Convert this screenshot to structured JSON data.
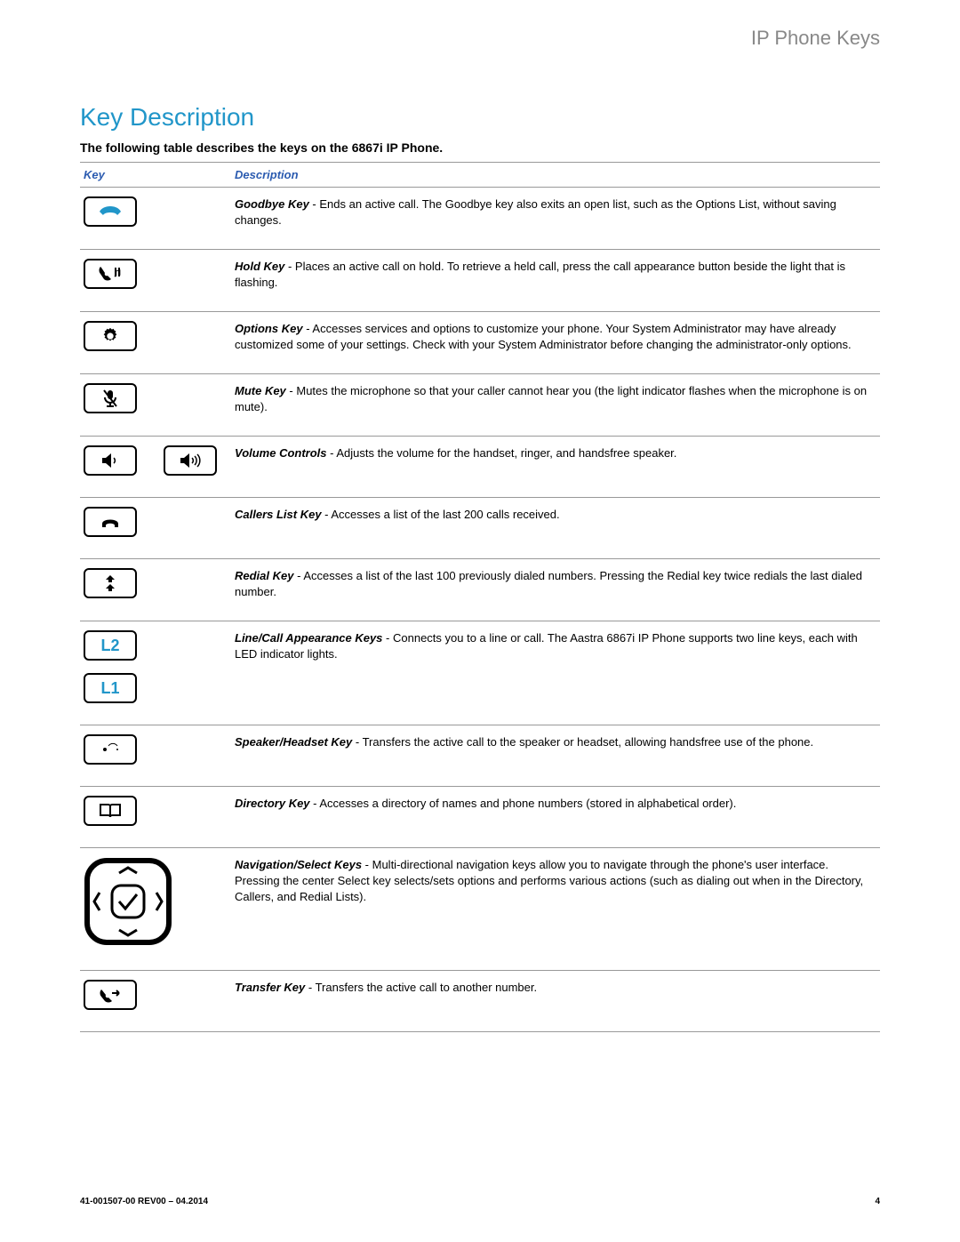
{
  "header": {
    "right_title": "IP Phone Keys"
  },
  "section": {
    "title": "Key Description"
  },
  "intro": "The following table describes the keys on the 6867i IP Phone.",
  "table": {
    "head": {
      "col1": "Key",
      "col2": "Description"
    },
    "rows": [
      {
        "icon": "goodbye",
        "label": "Goodbye Key",
        "sep": " - ",
        "text": "Ends an active call. The Goodbye key also exits an open list, such as the Options List, without saving changes."
      },
      {
        "icon": "hold",
        "label": "Hold Key",
        "sep": "  - ",
        "text": "Places an active call on hold. To retrieve a held call, press the call appearance button beside the light that is flashing."
      },
      {
        "icon": "options",
        "label": "Options Key",
        "sep": " - ",
        "text": "Accesses services and options to customize your phone. Your System Administrator may have already customized some of your settings. Check with your System Administrator before changing the administrator-only options."
      },
      {
        "icon": "mute",
        "label": "Mute Key",
        "sep": " - ",
        "text": "Mutes the microphone so that your caller cannot hear you (the light indicator flashes when the microphone is on mute)."
      },
      {
        "icon": "volume",
        "label": "Volume Controls",
        "sep": " - ",
        "text": "Adjusts the volume for the handset, ringer, and handsfree speaker."
      },
      {
        "icon": "callers",
        "label": "Callers List Key",
        "sep": " - ",
        "text": "Accesses a list of the last 200 calls received."
      },
      {
        "icon": "redial",
        "label": "Redial Key",
        "sep": " - ",
        "text": "Accesses a list of the last 100 previously dialed numbers. Pressing the Redial key twice redials the last dialed number."
      },
      {
        "icon": "lines",
        "label": "Line/Call Appearance Keys",
        "sep": "  - ",
        "text": "Connects you to a line or call. The Aastra 6867i IP Phone supports two line keys, each with LED indicator lights."
      },
      {
        "icon": "speaker",
        "label": "Speaker/Headset Key",
        "sep": "  - ",
        "text": "Transfers the active call to the speaker or headset, allowing handsfree use of the phone."
      },
      {
        "icon": "directory",
        "label": "Directory Key",
        "sep": "  - ",
        "text": "Accesses a directory of names and phone numbers (stored in alphabetical order)."
      },
      {
        "icon": "nav",
        "label": "Navigation/Select Keys",
        "sep": "  - ",
        "text": "Multi-directional navigation keys allow you to navigate through the phone's user interface. Pressing the center Select key selects/sets options and performs various actions (such as dialing out when in the Directory, Callers, and Redial Lists)."
      },
      {
        "icon": "transfer",
        "label": "Transfer Key",
        "sep": " - ",
        "text": "Transfers the active call to another number."
      }
    ]
  },
  "lines": {
    "l1": "L1",
    "l2": "L2"
  },
  "footer": {
    "left": "41-001507-00 REV00 – 04.2014",
    "right": "4"
  }
}
